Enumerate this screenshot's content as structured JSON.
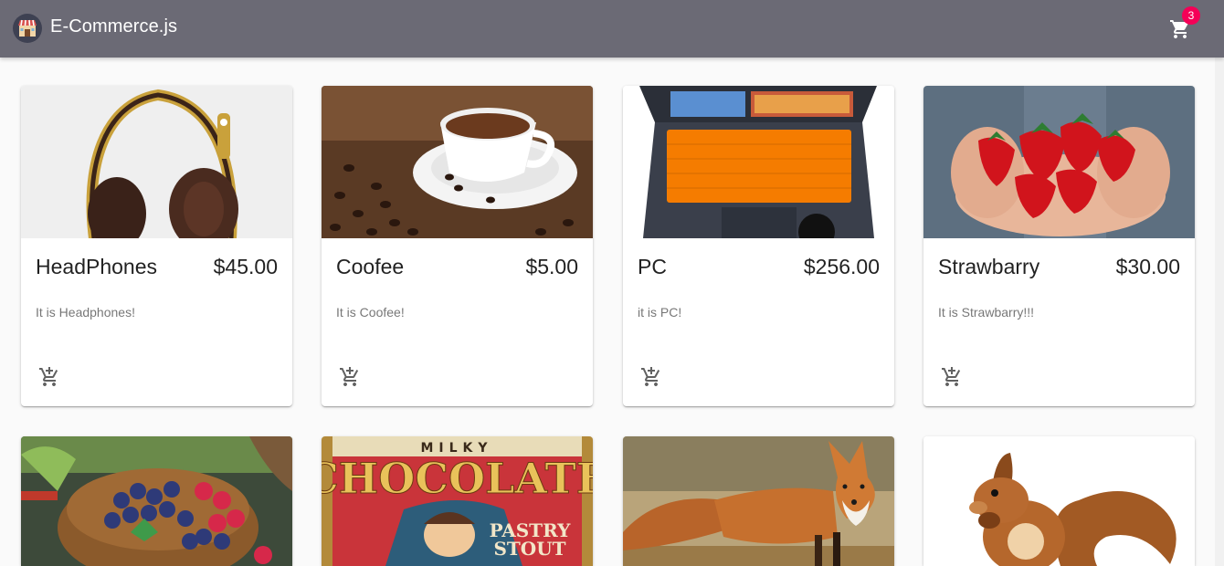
{
  "header": {
    "brand": "E-Commerce.js",
    "cart_count": "3",
    "logo_icon": "store-icon",
    "cart_icon": "shopping-cart-icon",
    "bar_color": "#6b6a75",
    "badge_color": "#f50057"
  },
  "products": [
    {
      "name": "HeadPhones",
      "price": "$45.00",
      "description": "It is Headphones!",
      "image": "headphones"
    },
    {
      "name": "Coofee",
      "price": "$5.00",
      "description": "It is Coofee!",
      "image": "coffee"
    },
    {
      "name": "PC",
      "price": "$256.00",
      "description": "it is PC!",
      "image": "laptop"
    },
    {
      "name": "Strawbarry",
      "price": "$30.00",
      "description": "It is Strawbarry!!!",
      "image": "strawberries"
    },
    {
      "name": "",
      "price": "",
      "description": "",
      "image": "berries-bowl"
    },
    {
      "name": "",
      "price": "",
      "description": "",
      "image": "milky-chocolate-can"
    },
    {
      "name": "",
      "price": "",
      "description": "",
      "image": "fox"
    },
    {
      "name": "",
      "price": "",
      "description": "",
      "image": "squirrel"
    }
  ],
  "can_label": {
    "top": "MILKY",
    "main": "CHOCOLATE",
    "sub1": "PASTRY",
    "sub2": "STOUT"
  },
  "add_icon": "add-shopping-cart-icon"
}
